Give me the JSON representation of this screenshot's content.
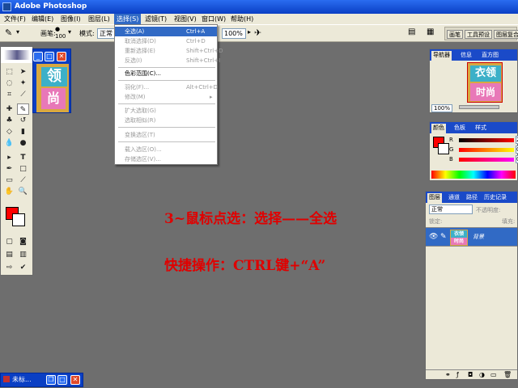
{
  "window": {
    "title": "Adobe Photoshop"
  },
  "menubar": {
    "items": [
      "文件(F)",
      "编辑(E)",
      "图像(I)",
      "图层(L)",
      "选择(S)",
      "滤镜(T)",
      "视图(V)",
      "窗口(W)",
      "帮助(H)"
    ]
  },
  "options": {
    "brush_label": "画笔:",
    "brush_size": "100",
    "mode_label": "模式:",
    "mode_value": "正常",
    "flow_value": "100%"
  },
  "palette_well": {
    "tabs": [
      "画笔",
      "工具预设",
      "图层复合"
    ]
  },
  "select_menu": {
    "items": [
      {
        "label": "全选(A)",
        "shortcut": "Ctrl+A",
        "enabled": true,
        "highlight": true
      },
      {
        "label": "取消选择(D)",
        "shortcut": "Ctrl+D",
        "enabled": false
      },
      {
        "label": "重新选择(E)",
        "shortcut": "Shift+Ctrl+D",
        "enabled": false
      },
      {
        "label": "反选(I)",
        "shortcut": "Shift+Ctrl+I",
        "enabled": false
      },
      {
        "label": "色彩范围(C)...",
        "shortcut": "",
        "enabled": true
      },
      {
        "label": "羽化(F)...",
        "shortcut": "Alt+Ctrl+D",
        "enabled": false
      },
      {
        "label": "修改(M)",
        "shortcut": "",
        "enabled": false,
        "submenu": true
      },
      {
        "label": "扩大选取(G)",
        "shortcut": "",
        "enabled": false
      },
      {
        "label": "选取相似(R)",
        "shortcut": "",
        "enabled": false
      },
      {
        "label": "变换选区(T)",
        "shortcut": "",
        "enabled": false
      },
      {
        "label": "载入选区(O)...",
        "shortcut": "",
        "enabled": false
      },
      {
        "label": "存储选区(V)...",
        "shortcut": "",
        "enabled": false
      }
    ]
  },
  "navigator": {
    "tabs": [
      "导航器",
      "信息",
      "直方图"
    ],
    "zoom": "100%"
  },
  "color": {
    "tabs": [
      "颜色",
      "色板",
      "样式"
    ],
    "sliders": [
      {
        "label": "R",
        "value": "253"
      },
      {
        "label": "G",
        "value": "0"
      },
      {
        "label": "B",
        "value": "0"
      }
    ]
  },
  "layers": {
    "tabs": [
      "图层",
      "通道",
      "路径",
      "历史记录"
    ],
    "blend_mode": "正常",
    "opacity_label": "不透明度:",
    "lock_label": "锁定:",
    "fill_label": "填充:",
    "layer_name": "背景"
  },
  "document": {
    "thumb_text_top": "领",
    "thumb_text_bottom": "尚"
  },
  "navigator_thumb": {
    "top": "衣领",
    "bottom": "时尚"
  },
  "layer_thumb": {
    "top": "衣领",
    "bottom": "时尚"
  },
  "overlay": {
    "line1": "3~鼠标点选：选择——全选",
    "line2": "快捷操作：CTRL键+“A”"
  },
  "taskbar": {
    "label": "未标..."
  },
  "colors": {
    "accent": "#316ac5",
    "overlay_text": "#e00000",
    "foreground": "#ff0000"
  }
}
